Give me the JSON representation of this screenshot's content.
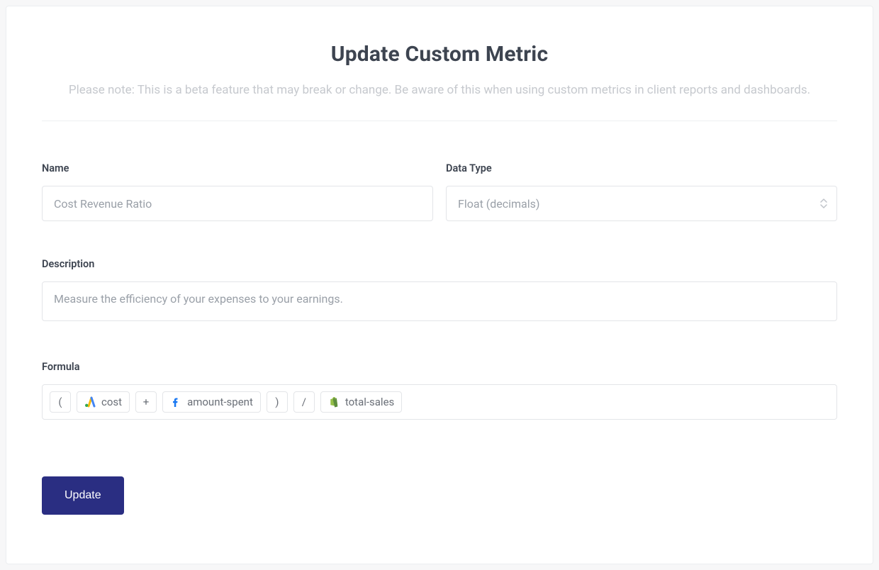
{
  "header": {
    "title": "Update Custom Metric",
    "subtitle": "Please note: This is a beta feature that may break or change. Be aware of this when using custom metrics in client reports and dashboards."
  },
  "form": {
    "name": {
      "label": "Name",
      "value": "Cost Revenue Ratio"
    },
    "dataType": {
      "label": "Data Type",
      "value": "Float (decimals)"
    },
    "description": {
      "label": "Description",
      "value": "Measure the efficiency of your expenses to your earnings."
    },
    "formula": {
      "label": "Formula",
      "tokens": [
        {
          "type": "op",
          "text": "("
        },
        {
          "type": "metric",
          "icon": "google-ads",
          "text": "cost"
        },
        {
          "type": "op",
          "text": "+"
        },
        {
          "type": "metric",
          "icon": "facebook",
          "text": "amount-spent"
        },
        {
          "type": "op",
          "text": ")"
        },
        {
          "type": "op",
          "text": "/"
        },
        {
          "type": "metric",
          "icon": "shopify",
          "text": "total-sales"
        }
      ]
    }
  },
  "actions": {
    "submit_label": "Update"
  }
}
